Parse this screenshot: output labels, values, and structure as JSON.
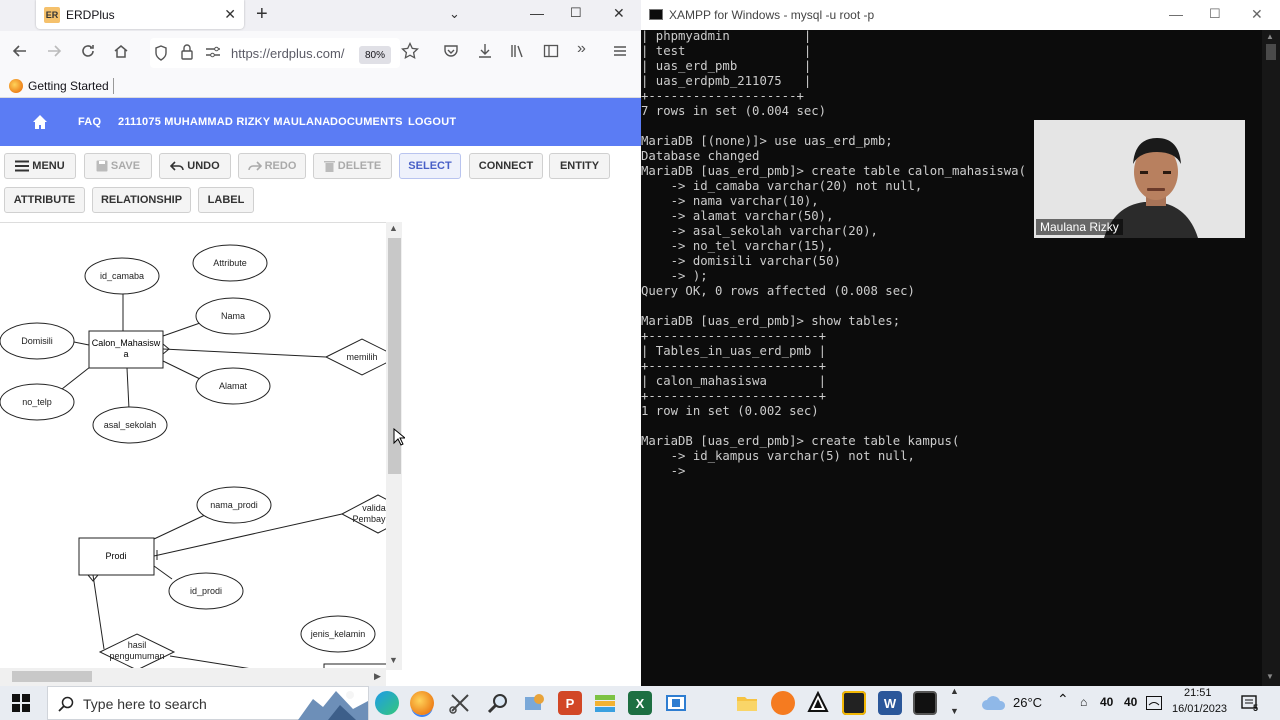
{
  "browser": {
    "tab_title": "ERDPlus",
    "favicon_text": "ER",
    "url": "https://erdplus.com/",
    "zoom": "80%",
    "bookmark": "Getting Started",
    "icons": [
      "back-arrow-icon",
      "forward-arrow-icon",
      "reload-icon",
      "home-icon",
      "shield-icon",
      "lock-icon",
      "permissions-icon",
      "star-icon",
      "pocket-icon",
      "download-icon",
      "library-icon",
      "sidebar-icon",
      "overflow-icon",
      "hamburger-menu-icon"
    ]
  },
  "app": {
    "nav": [
      "FAQ",
      "2111075 MUHAMMAD RIZKY MAULANA",
      "DOCUMENTS",
      "LOGOUT"
    ],
    "toolbar": {
      "menu": "MENU",
      "save": "SAVE",
      "undo": "UNDO",
      "redo": "REDO",
      "delete": "DELETE",
      "select": "SELECT",
      "connect": "CONNECT",
      "entity": "ENTITY",
      "attribute": "ATTRIBUTE",
      "relationship": "RELATIONSHIP",
      "label": "LABEL"
    },
    "diagram": {
      "entities": [
        "Calon_Mahasisw",
        "a",
        "Prodi"
      ],
      "attributes": [
        "id_camaba",
        "Attribute",
        "Nama",
        "Domisili",
        "Alamat",
        "no_telp",
        "asal_sekolah",
        "nama_prodi",
        "id_prodi",
        "jenis_kelamin"
      ],
      "relationships": [
        "memilih",
        "valida",
        "Pembay",
        "hasil",
        "pengumuman"
      ]
    }
  },
  "terminal": {
    "title": "XAMPP for Windows - mysql  -u root -p",
    "lines": [
      "| phpmyadmin          |",
      "| test                |",
      "| uas_erd_pmb         |",
      "| uas_erdpmb_211075   |",
      "+--------------------+",
      "7 rows in set (0.004 sec)",
      "",
      "MariaDB [(none)]> use uas_erd_pmb;",
      "Database changed",
      "MariaDB [uas_erd_pmb]> create table calon_mahasiswa(",
      "    -> id_camaba varchar(20) not null,",
      "    -> nama varchar(10),",
      "    -> alamat varchar(50),",
      "    -> asal_sekolah varchar(20),",
      "    -> no_tel varchar(15),",
      "    -> domisili varchar(50)",
      "    -> );",
      "Query OK, 0 rows affected (0.008 sec)",
      "",
      "MariaDB [uas_erd_pmb]> show tables;",
      "+-----------------------+",
      "| Tables_in_uas_erd_pmb |",
      "+-----------------------+",
      "| calon_mahasiswa       |",
      "+-----------------------+",
      "1 row in set (0.002 sec)",
      "",
      "MariaDB [uas_erd_pmb]> create table kampus(",
      "    -> id_kampus varchar(5) not null,",
      "    -> "
    ],
    "webcam_name": "Maulana Rizky"
  },
  "taskbar": {
    "search_placeholder": "Type here to search",
    "temperature": "26°C",
    "badge_1": "40",
    "badge_2": "40",
    "time": "21:51",
    "date": "16/01/2023",
    "notification_count": "5"
  },
  "colors": {
    "app_nav": "#5b7cf4",
    "terminal_bg": "#0c0c0c",
    "terminal_fg": "#cccccc"
  }
}
